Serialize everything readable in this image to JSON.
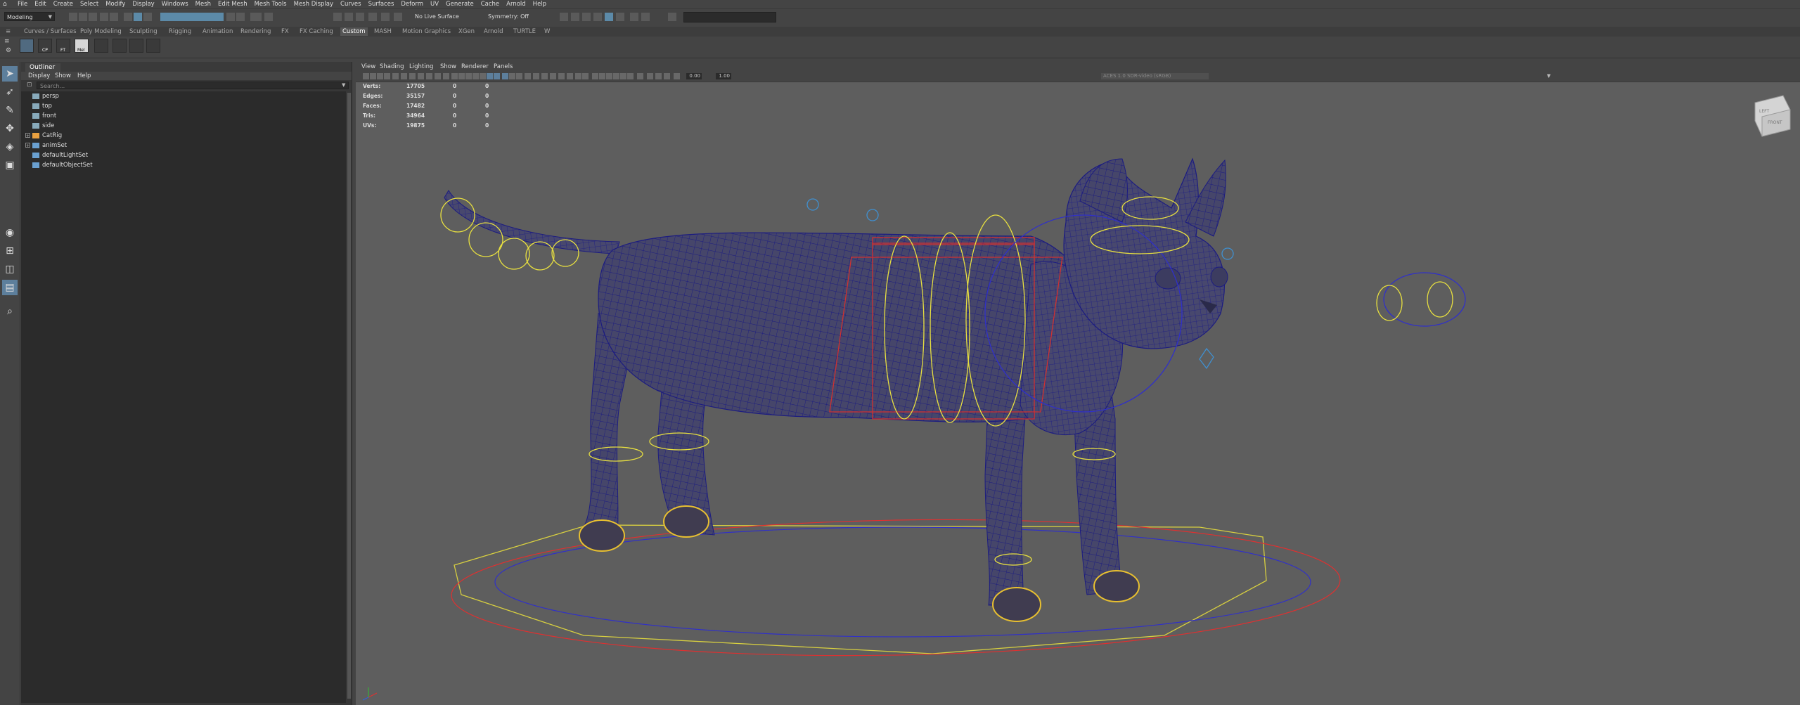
{
  "menubar": {
    "items": [
      "File",
      "Edit",
      "Create",
      "Select",
      "Modify",
      "Display",
      "Windows",
      "Mesh",
      "Edit Mesh",
      "Mesh Tools",
      "Mesh Display",
      "Curves",
      "Surfaces",
      "Deform",
      "UV",
      "Generate",
      "Cache",
      "Arnold",
      "Help"
    ]
  },
  "statusline": {
    "mode": "Modeling",
    "live_surface": "No Live Surface",
    "symmetry": "Symmetry: Off"
  },
  "shelf": {
    "tabs": [
      "Curves / Surfaces",
      "Poly Modeling",
      "Sculpting",
      "Rigging",
      "Animation",
      "Rendering",
      "FX",
      "FX Caching",
      "Custom",
      "MASH",
      "Motion Graphics",
      "XGen",
      "Arnold",
      "TURTLE"
    ],
    "active_tab": "Custom",
    "icon_labels": [
      "CP",
      "FT",
      "Mel"
    ]
  },
  "outliner": {
    "title": "Outliner",
    "menus": [
      "Display",
      "Show",
      "Help"
    ],
    "search_placeholder": "Search...",
    "items": [
      {
        "label": "persp",
        "icon": "camera-icon",
        "expandable": false
      },
      {
        "label": "top",
        "icon": "camera-icon",
        "expandable": false
      },
      {
        "label": "front",
        "icon": "camera-icon",
        "expandable": false
      },
      {
        "label": "side",
        "icon": "camera-icon",
        "expandable": false
      },
      {
        "label": "CatRig",
        "icon": "transform-icon",
        "expandable": true
      },
      {
        "label": "animSet",
        "icon": "set-icon",
        "expandable": true
      },
      {
        "label": "defaultLightSet",
        "icon": "set-icon",
        "expandable": false
      },
      {
        "label": "defaultObjectSet",
        "icon": "set-icon",
        "expandable": false
      }
    ]
  },
  "viewport": {
    "menus": [
      "View",
      "Shading",
      "Lighting",
      "Show",
      "Renderer",
      "Panels"
    ],
    "near_value": "0.00",
    "far_value": "1.00",
    "color_space": "ACES 1.0 SDR-video (sRGB)",
    "hud": {
      "rows": [
        {
          "label": "Verts:",
          "v1": "17705",
          "v2": "0",
          "v3": "0"
        },
        {
          "label": "Edges:",
          "v1": "35157",
          "v2": "0",
          "v3": "0"
        },
        {
          "label": "Faces:",
          "v1": "17482",
          "v2": "0",
          "v3": "0"
        },
        {
          "label": "Tris:",
          "v1": "34964",
          "v2": "0",
          "v3": "0"
        },
        {
          "label": "UVs:",
          "v1": "19875",
          "v2": "0",
          "v3": "0"
        }
      ]
    },
    "view_cube": {
      "left": "LEFT",
      "front": "FRONT"
    }
  },
  "colors": {
    "mesh": "#4a4a6e",
    "wire": "#1a1a8a",
    "control_yellow": "#e8e040",
    "control_red": "#e03030",
    "control_blue": "#3030d0",
    "selected_blue": "#5d7f9c"
  }
}
